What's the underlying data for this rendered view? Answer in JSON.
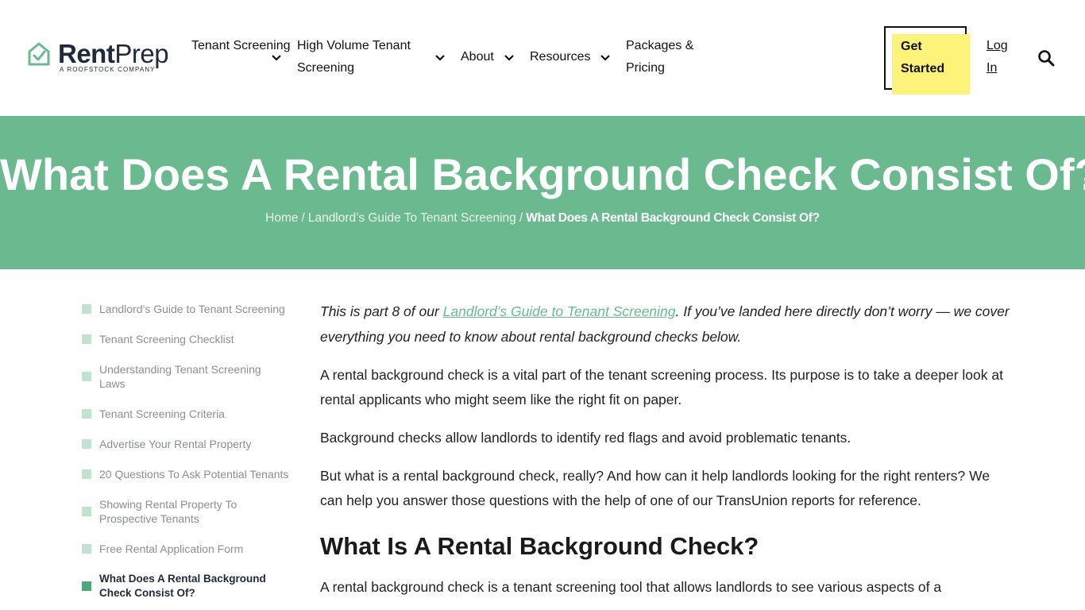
{
  "header": {
    "logo": {
      "word_bold": "Rent",
      "word_light": "Prep",
      "tagline": "A ROOFSTOCK COMPANY",
      "brand_color": "#6ab98f"
    },
    "nav": [
      {
        "label": "Tenant Screening",
        "has_dropdown": true
      },
      {
        "label": "High Volume Tenant Screening",
        "has_dropdown": true
      },
      {
        "label": "About",
        "has_dropdown": true
      },
      {
        "label": "Resources",
        "has_dropdown": true
      },
      {
        "label": "Packages & Pricing",
        "has_dropdown": false
      }
    ],
    "cta_label": "Get Started",
    "cta_highlight_color": "#fdf27a",
    "login_label": "Log In",
    "search_icon": "search-icon"
  },
  "hero": {
    "title": "What Does A Rental Background Check Consist Of?",
    "background_color": "#6ab98f",
    "breadcrumb": {
      "home": "Home",
      "separator": "/",
      "parent": "Landlord’s Guide To Tenant Screening",
      "current": "What Does A Rental Background Check Consist Of?"
    }
  },
  "sidebar": {
    "items": [
      {
        "label": "Landlord’s Guide to Tenant Screening",
        "active": false
      },
      {
        "label": "Tenant Screening Checklist",
        "active": false
      },
      {
        "label": "Understanding Tenant Screening Laws",
        "active": false
      },
      {
        "label": "Tenant Screening Criteria",
        "active": false
      },
      {
        "label": "Advertise Your Rental Property",
        "active": false
      },
      {
        "label": "20 Questions To Ask Potential Tenants",
        "active": false
      },
      {
        "label": "Showing Rental Property To Prospective Tenants",
        "active": false
      },
      {
        "label": "Free Rental Application Form",
        "active": false
      },
      {
        "label": "What Does A Rental Background Check Consist Of?",
        "active": true
      }
    ]
  },
  "main": {
    "intro_before": "This is part 8 of our ",
    "intro_link": "Landlord’s Guide to Tenant Screening",
    "intro_after": ". If you’ve landed here directly don’t worry — we cover everything you need to know about rental background checks below.",
    "p1": "A rental background check is a vital part of the tenant screening process. Its purpose is to take a deeper look at rental applicants who might seem like the right fit on paper.",
    "p2": "Background checks allow landlords to identify red flags and avoid problematic tenants.",
    "p3": "But what is a rental background check, really? And how can it help landlords looking for the right renters? We can help you answer those questions with the help of one of our TransUnion reports for reference.",
    "h2": "What Is A Rental Background Check?",
    "p4": "A rental background check is a tenant screening tool that allows landlords to see various aspects of a"
  }
}
